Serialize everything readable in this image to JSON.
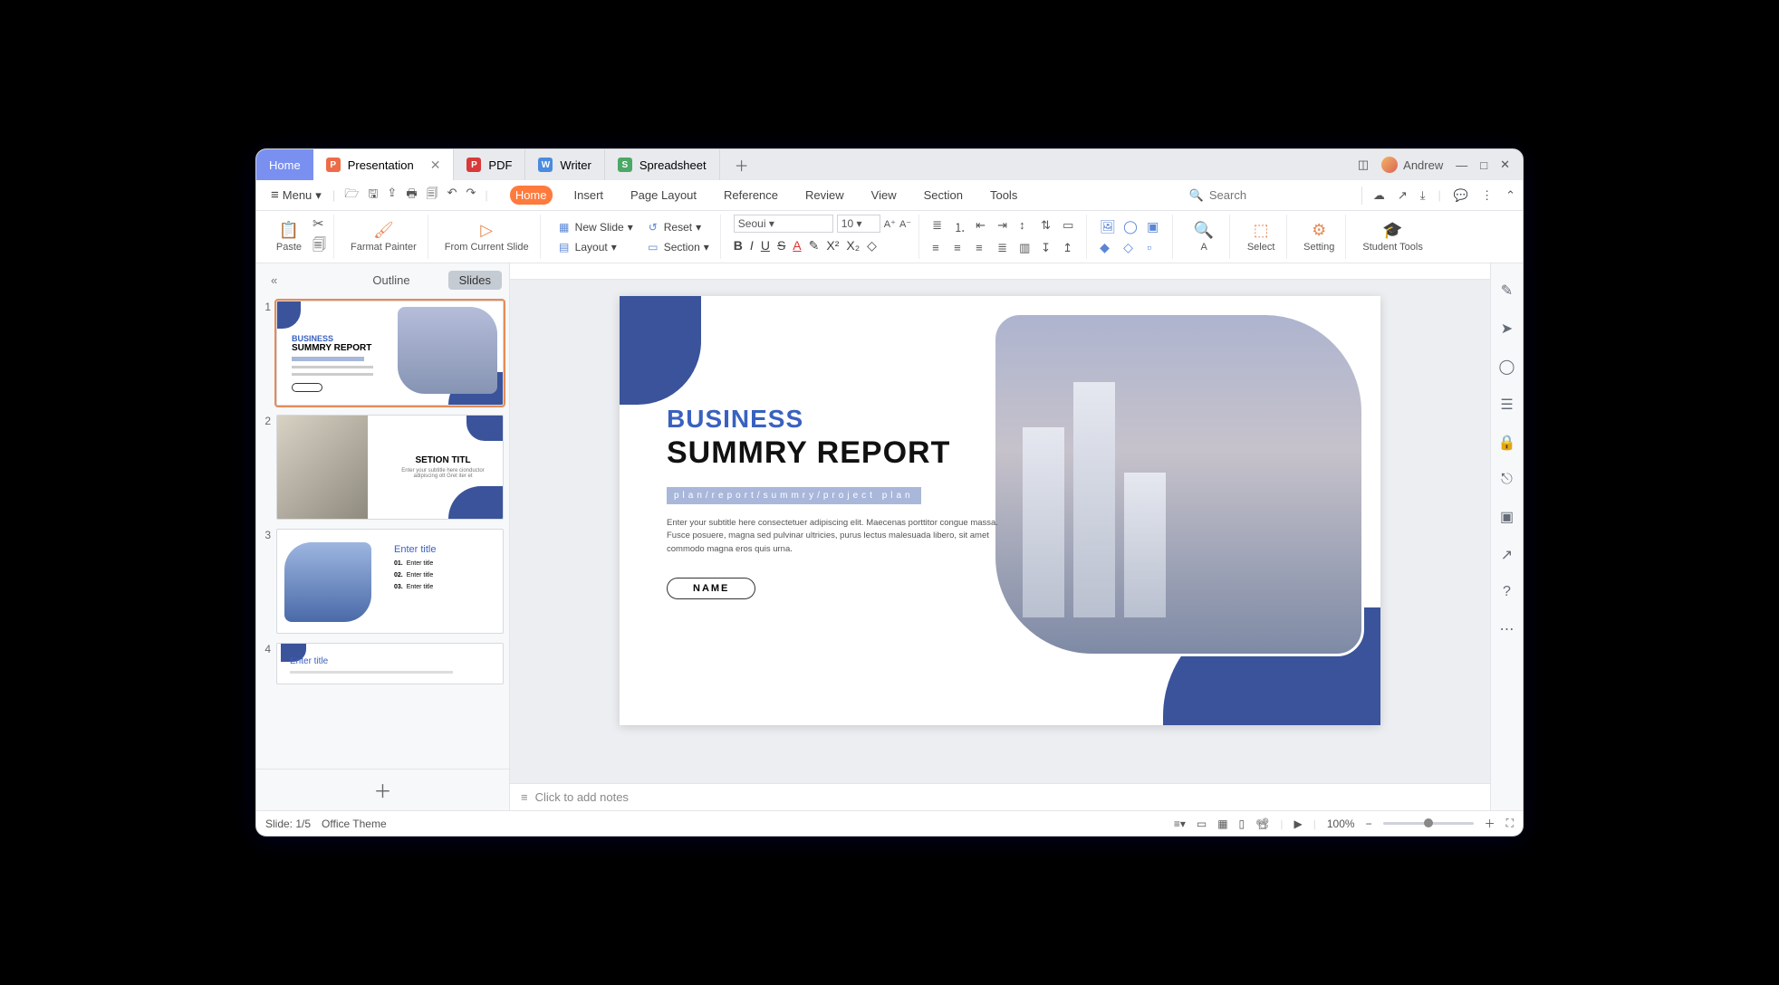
{
  "titlebar": {
    "home": "Home",
    "tabs": [
      {
        "icon": "P",
        "label": "Presentation",
        "closable": true,
        "active": true
      },
      {
        "icon": "P",
        "label": "PDF"
      },
      {
        "icon": "W",
        "label": "Writer"
      },
      {
        "icon": "S",
        "label": "Spreadsheet"
      }
    ],
    "user": "Andrew"
  },
  "menubar": {
    "menu": "Menu",
    "ribbons": [
      "Home",
      "Insert",
      "Page Layout",
      "Reference",
      "Review",
      "View",
      "Section",
      "Tools"
    ],
    "active_ribbon": "Home",
    "search_placeholder": "Search"
  },
  "toolbar": {
    "paste": "Paste",
    "format_painter": "Farmat Painter",
    "from_current": "From Current Slide",
    "new_slide": "New Slide",
    "layout": "Layout",
    "reset": "Reset",
    "section": "Section",
    "font_name": "Seoui",
    "font_size": "10",
    "select": "Select",
    "setting": "Setting",
    "student_tools": "Student Tools"
  },
  "side": {
    "tabs": {
      "outline": "Outline",
      "slides": "Slides"
    }
  },
  "slide": {
    "heading1": "BUSINESS",
    "heading2": "SUMMRY REPORT",
    "subbar": "plan/report/summry/project plan",
    "body": "Enter your subtitle here consectetuer adipiscing elit. Maecenas porttitor congue massa. Fusce posuere, magna sed pulvinar ultricies, purus lectus malesuada libero, sit amet commodo magna eros quis urna.",
    "name": "NAME"
  },
  "thumbs": {
    "t1_h1": "BUSINESS",
    "t1_h2": "SUMMRY REPORT",
    "t2_title": "SETION TITL",
    "t2_sub": "Enter your subtitle here cionductor adipiscing ott Gret iter et",
    "t3_title": "Enter title",
    "t3_i1": "01.",
    "t3_i2": "02.",
    "t3_i3": "03.",
    "t3_lab": "Enter title",
    "t4_title": "Enter title"
  },
  "notes": "Click to add notes",
  "status": {
    "slide": "Slide: 1/5",
    "theme": "Office Theme",
    "zoom": "100%"
  }
}
